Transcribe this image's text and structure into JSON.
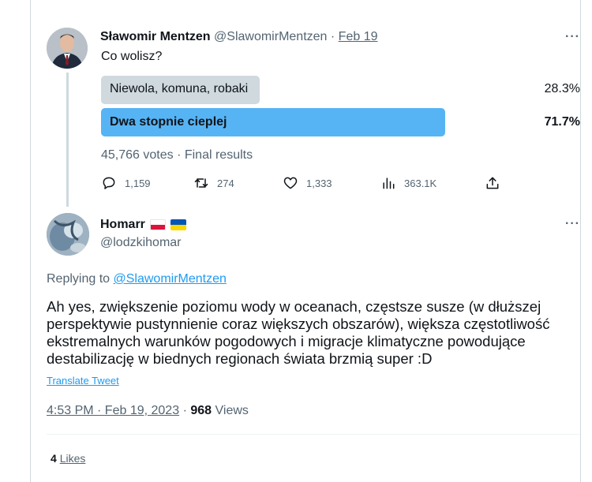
{
  "parent_tweet": {
    "author_name": "Sławomir Mentzen",
    "author_handle": "@SlawomirMentzen",
    "separator": "·",
    "date": "Feb 19",
    "text": "Co wolisz?",
    "poll": {
      "options": [
        {
          "label": "Niewola, komuna, robaki",
          "percent": "28.3%",
          "share": 0.283
        },
        {
          "label": "Dwa stopnie cieplej",
          "percent": "71.7%",
          "share": 0.717
        }
      ],
      "meta": "45,766 votes · Final results"
    },
    "actions": {
      "replies": "1,159",
      "retweets": "274",
      "likes": "1,333",
      "views": "363.1K"
    },
    "more_icon": "more-horizontal-icon"
  },
  "reply_tweet": {
    "author_name": "Homarr",
    "author_handle": "@lodzkihomar",
    "flags": [
      "poland-flag",
      "ukraine-flag"
    ],
    "replying_to_label": "Replying to",
    "replying_to_handle": "@SlawomirMentzen",
    "text": "Ah yes, zwiększenie poziomu wody w oceanach, częstsze susze (w dłuższej perspektywie pustynnienie coraz większych obszarów), większa częstotliwość ekstremalnych warunków pogodowych i migracje klimatyczne powodujące destabilizację w biednych regionach świata brzmią super :D",
    "translate_label": "Translate Tweet",
    "timestamp": "4:53 PM · Feb 19, 2023",
    "dot": "·",
    "views_count": "968",
    "views_label": "Views",
    "likes_count": "4",
    "likes_label": "Likes",
    "more_icon": "more-horizontal-icon"
  },
  "colors": {
    "accent": "#1d9bf0",
    "secondary_text": "#536471",
    "poll_losing_bar": "#cfd9de"
  }
}
